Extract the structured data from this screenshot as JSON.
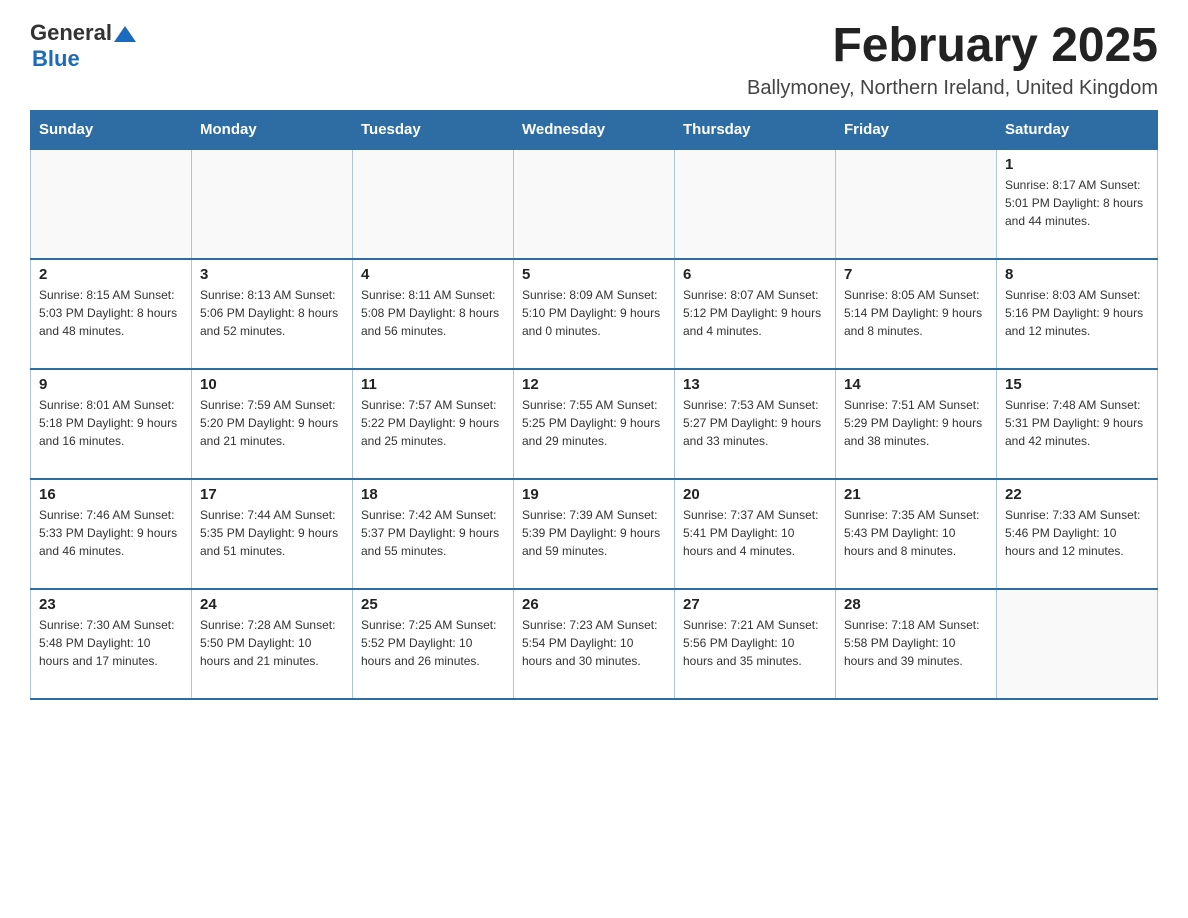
{
  "header": {
    "logo_general": "General",
    "logo_blue": "Blue",
    "month_title": "February 2025",
    "subtitle": "Ballymoney, Northern Ireland, United Kingdom"
  },
  "days_of_week": [
    "Sunday",
    "Monday",
    "Tuesday",
    "Wednesday",
    "Thursday",
    "Friday",
    "Saturday"
  ],
  "weeks": [
    {
      "days": [
        {
          "number": "",
          "info": ""
        },
        {
          "number": "",
          "info": ""
        },
        {
          "number": "",
          "info": ""
        },
        {
          "number": "",
          "info": ""
        },
        {
          "number": "",
          "info": ""
        },
        {
          "number": "",
          "info": ""
        },
        {
          "number": "1",
          "info": "Sunrise: 8:17 AM\nSunset: 5:01 PM\nDaylight: 8 hours and 44 minutes."
        }
      ]
    },
    {
      "days": [
        {
          "number": "2",
          "info": "Sunrise: 8:15 AM\nSunset: 5:03 PM\nDaylight: 8 hours and 48 minutes."
        },
        {
          "number": "3",
          "info": "Sunrise: 8:13 AM\nSunset: 5:06 PM\nDaylight: 8 hours and 52 minutes."
        },
        {
          "number": "4",
          "info": "Sunrise: 8:11 AM\nSunset: 5:08 PM\nDaylight: 8 hours and 56 minutes."
        },
        {
          "number": "5",
          "info": "Sunrise: 8:09 AM\nSunset: 5:10 PM\nDaylight: 9 hours and 0 minutes."
        },
        {
          "number": "6",
          "info": "Sunrise: 8:07 AM\nSunset: 5:12 PM\nDaylight: 9 hours and 4 minutes."
        },
        {
          "number": "7",
          "info": "Sunrise: 8:05 AM\nSunset: 5:14 PM\nDaylight: 9 hours and 8 minutes."
        },
        {
          "number": "8",
          "info": "Sunrise: 8:03 AM\nSunset: 5:16 PM\nDaylight: 9 hours and 12 minutes."
        }
      ]
    },
    {
      "days": [
        {
          "number": "9",
          "info": "Sunrise: 8:01 AM\nSunset: 5:18 PM\nDaylight: 9 hours and 16 minutes."
        },
        {
          "number": "10",
          "info": "Sunrise: 7:59 AM\nSunset: 5:20 PM\nDaylight: 9 hours and 21 minutes."
        },
        {
          "number": "11",
          "info": "Sunrise: 7:57 AM\nSunset: 5:22 PM\nDaylight: 9 hours and 25 minutes."
        },
        {
          "number": "12",
          "info": "Sunrise: 7:55 AM\nSunset: 5:25 PM\nDaylight: 9 hours and 29 minutes."
        },
        {
          "number": "13",
          "info": "Sunrise: 7:53 AM\nSunset: 5:27 PM\nDaylight: 9 hours and 33 minutes."
        },
        {
          "number": "14",
          "info": "Sunrise: 7:51 AM\nSunset: 5:29 PM\nDaylight: 9 hours and 38 minutes."
        },
        {
          "number": "15",
          "info": "Sunrise: 7:48 AM\nSunset: 5:31 PM\nDaylight: 9 hours and 42 minutes."
        }
      ]
    },
    {
      "days": [
        {
          "number": "16",
          "info": "Sunrise: 7:46 AM\nSunset: 5:33 PM\nDaylight: 9 hours and 46 minutes."
        },
        {
          "number": "17",
          "info": "Sunrise: 7:44 AM\nSunset: 5:35 PM\nDaylight: 9 hours and 51 minutes."
        },
        {
          "number": "18",
          "info": "Sunrise: 7:42 AM\nSunset: 5:37 PM\nDaylight: 9 hours and 55 minutes."
        },
        {
          "number": "19",
          "info": "Sunrise: 7:39 AM\nSunset: 5:39 PM\nDaylight: 9 hours and 59 minutes."
        },
        {
          "number": "20",
          "info": "Sunrise: 7:37 AM\nSunset: 5:41 PM\nDaylight: 10 hours and 4 minutes."
        },
        {
          "number": "21",
          "info": "Sunrise: 7:35 AM\nSunset: 5:43 PM\nDaylight: 10 hours and 8 minutes."
        },
        {
          "number": "22",
          "info": "Sunrise: 7:33 AM\nSunset: 5:46 PM\nDaylight: 10 hours and 12 minutes."
        }
      ]
    },
    {
      "days": [
        {
          "number": "23",
          "info": "Sunrise: 7:30 AM\nSunset: 5:48 PM\nDaylight: 10 hours and 17 minutes."
        },
        {
          "number": "24",
          "info": "Sunrise: 7:28 AM\nSunset: 5:50 PM\nDaylight: 10 hours and 21 minutes."
        },
        {
          "number": "25",
          "info": "Sunrise: 7:25 AM\nSunset: 5:52 PM\nDaylight: 10 hours and 26 minutes."
        },
        {
          "number": "26",
          "info": "Sunrise: 7:23 AM\nSunset: 5:54 PM\nDaylight: 10 hours and 30 minutes."
        },
        {
          "number": "27",
          "info": "Sunrise: 7:21 AM\nSunset: 5:56 PM\nDaylight: 10 hours and 35 minutes."
        },
        {
          "number": "28",
          "info": "Sunrise: 7:18 AM\nSunset: 5:58 PM\nDaylight: 10 hours and 39 minutes."
        },
        {
          "number": "",
          "info": ""
        }
      ]
    }
  ]
}
